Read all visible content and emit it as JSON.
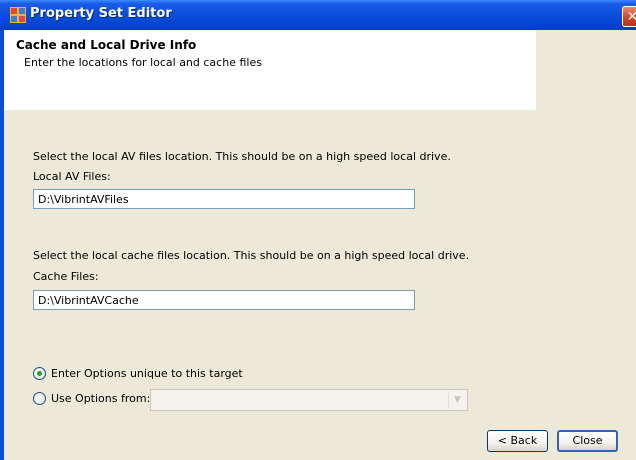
{
  "window": {
    "title": "Property Set Editor",
    "icons": {
      "app": "property-set-editor-icon",
      "close": "close-icon"
    }
  },
  "header": {
    "title": "Cache and Local Drive Info",
    "subtitle": "Enter the locations for local and cache files"
  },
  "local_av": {
    "description": "Select the local AV files location.  This should be on a high speed local drive.",
    "label": "Local AV Files:",
    "value": "D:\\VibrintAVFiles"
  },
  "cache": {
    "description": "Select the local cache files location.  This should be on a high speed local drive.",
    "label": "Cache Files:",
    "value": "D:\\VibrintAVCache"
  },
  "options": {
    "unique_label": "Enter Options unique to this target",
    "unique_selected": true,
    "use_from_label": "Use Options from:",
    "use_from_selected": false,
    "use_from_value": ""
  },
  "buttons": {
    "back": "< Back",
    "close": "Close"
  },
  "colors": {
    "titlebar": "#0a4fdc",
    "dialog_bg": "#ece9d8",
    "radio_selected": "#21a121"
  }
}
